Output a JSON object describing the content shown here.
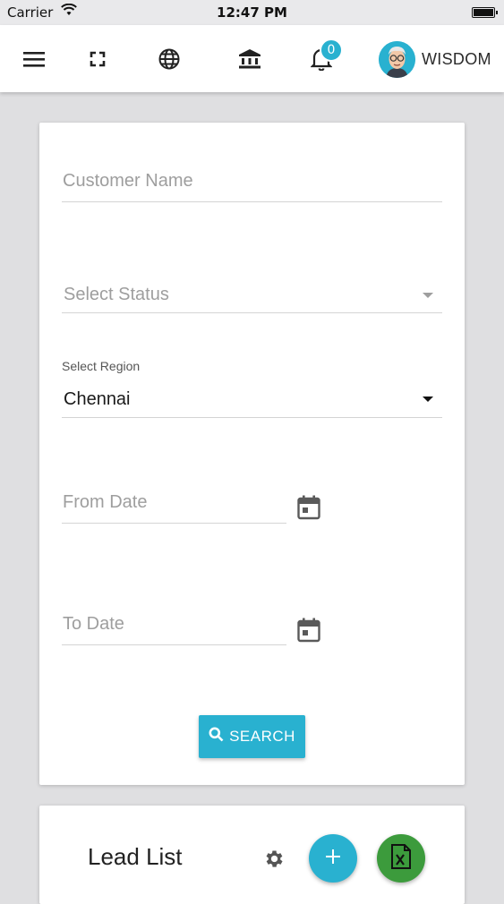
{
  "status_bar": {
    "carrier": "Carrier",
    "time": "12:47 PM"
  },
  "nav": {
    "notification_count": "0",
    "username": "WISDOM",
    "icons": [
      "menu-icon",
      "fullscreen-icon",
      "globe-icon",
      "bank-icon",
      "bell-icon"
    ]
  },
  "filters": {
    "customer_name": {
      "placeholder": "Customer Name"
    },
    "status": {
      "placeholder": "Select Status"
    },
    "region": {
      "label": "Select Region",
      "value": "Chennai"
    },
    "from_date": {
      "placeholder": "From Date"
    },
    "to_date": {
      "placeholder": "To Date"
    },
    "search_label": "SEARCH"
  },
  "lead_list": {
    "title": "Lead List"
  },
  "colors": {
    "accent": "#29b1d0",
    "excel_green": "#3c9b3c",
    "background": "#dfdfe1"
  }
}
